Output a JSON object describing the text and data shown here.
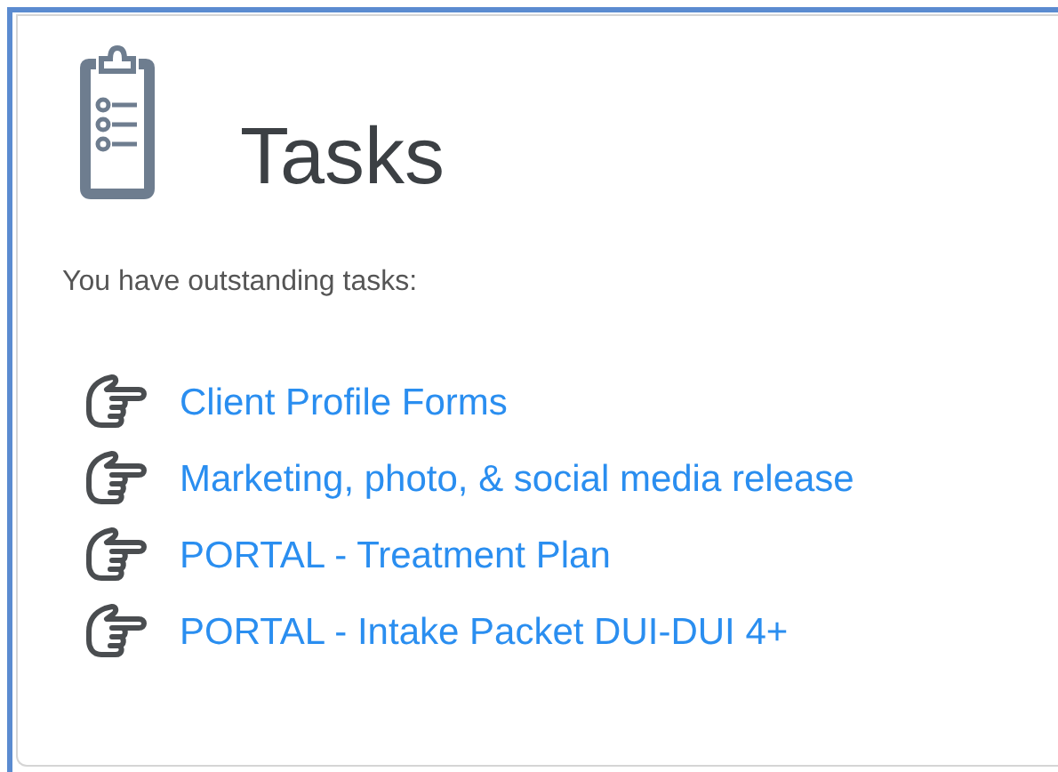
{
  "title": "Tasks",
  "intro": "You have outstanding tasks:",
  "tasks": [
    {
      "label": "Client Profile Forms"
    },
    {
      "label": "Marketing, photo, & social media release"
    },
    {
      "label": "PORTAL - Treatment Plan"
    },
    {
      "label": "PORTAL - Intake Packet DUI-DUI 4+"
    }
  ]
}
